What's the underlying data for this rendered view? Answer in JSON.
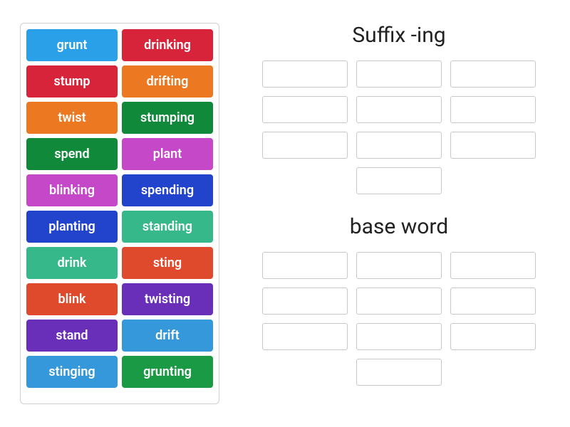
{
  "word_bank": [
    {
      "label": "grunt",
      "color": "c-blue1"
    },
    {
      "label": "drinking",
      "color": "c-red"
    },
    {
      "label": "stump",
      "color": "c-red"
    },
    {
      "label": "drifting",
      "color": "c-orange"
    },
    {
      "label": "twist",
      "color": "c-orange"
    },
    {
      "label": "stumping",
      "color": "c-green1"
    },
    {
      "label": "spend",
      "color": "c-green1"
    },
    {
      "label": "plant",
      "color": "c-magenta"
    },
    {
      "label": "blinking",
      "color": "c-magenta"
    },
    {
      "label": "spending",
      "color": "c-blue2"
    },
    {
      "label": "planting",
      "color": "c-blue2"
    },
    {
      "label": "standing",
      "color": "c-teal"
    },
    {
      "label": "drink",
      "color": "c-teal"
    },
    {
      "label": "sting",
      "color": "c-red2"
    },
    {
      "label": "blink",
      "color": "c-red2"
    },
    {
      "label": "twisting",
      "color": "c-purple"
    },
    {
      "label": "stand",
      "color": "c-purple"
    },
    {
      "label": "drift",
      "color": "c-blue3"
    },
    {
      "label": "stinging",
      "color": "c-blue3"
    },
    {
      "label": "grunting",
      "color": "c-green2"
    }
  ],
  "groups": [
    {
      "title": "Suffix -ing",
      "slot_count": 10
    },
    {
      "title": "base word",
      "slot_count": 10
    }
  ]
}
